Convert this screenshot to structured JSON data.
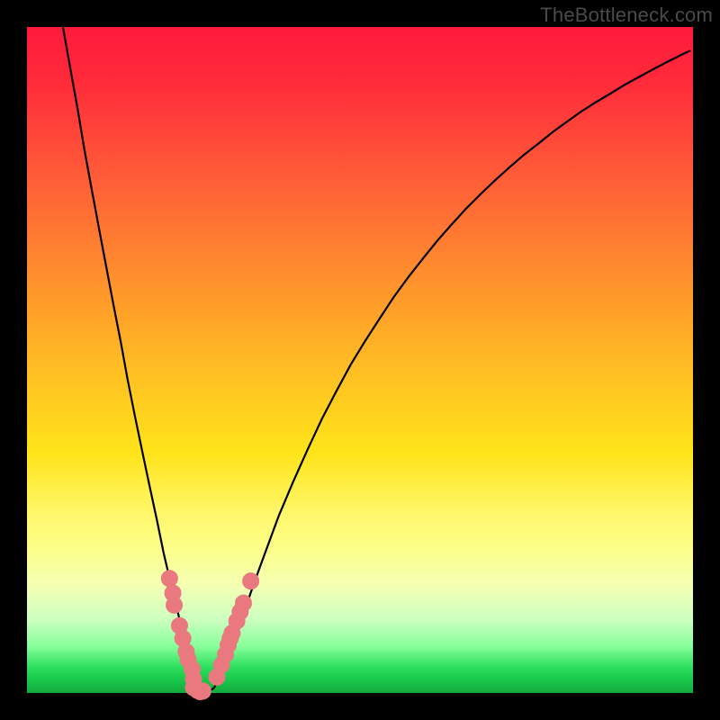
{
  "attribution": "TheBottleneck.com",
  "chart_data": {
    "type": "line",
    "title": "",
    "xlabel": "",
    "ylabel": "",
    "xlim": [
      0,
      100
    ],
    "ylim": [
      0,
      100
    ],
    "series": [
      {
        "name": "curve",
        "x": [
          5.4,
          6.5,
          7.6,
          8.6,
          9.7,
          10.8,
          11.9,
          13.0,
          14.1,
          15.1,
          16.2,
          17.3,
          18.4,
          19.5,
          20.5,
          21.6,
          22.1,
          22.7,
          23.2,
          23.5,
          23.8,
          24.3,
          24.9,
          25.9,
          27.0,
          28.1,
          28.6,
          29.2,
          29.7,
          30.3,
          30.8,
          31.4,
          32.4,
          33.5,
          34.6,
          35.7,
          37.8,
          40.0,
          42.2,
          44.3,
          46.5,
          48.6,
          50.8,
          53.0,
          55.1,
          57.3,
          59.5,
          61.6,
          63.8,
          65.9,
          68.1,
          70.3,
          72.4,
          74.6,
          76.8,
          78.9,
          81.1,
          83.2,
          85.4,
          87.6,
          89.7,
          91.9,
          94.1,
          96.2,
          98.4,
          99.5
        ],
        "values": [
          100.0,
          93.8,
          87.7,
          81.7,
          75.7,
          69.8,
          64.0,
          58.2,
          52.6,
          47.1,
          41.6,
          36.3,
          31.1,
          26.0,
          21.1,
          16.4,
          14.1,
          11.9,
          9.7,
          8.6,
          7.6,
          5.5,
          3.6,
          1.1,
          0.0,
          0.8,
          1.7,
          2.8,
          4.1,
          5.5,
          7.0,
          8.5,
          11.6,
          14.8,
          17.9,
          20.9,
          26.6,
          31.8,
          36.7,
          41.2,
          45.4,
          49.3,
          52.9,
          56.3,
          59.5,
          62.5,
          65.3,
          67.9,
          70.4,
          72.7,
          74.9,
          77.0,
          78.9,
          80.8,
          82.5,
          84.2,
          85.8,
          87.3,
          88.7,
          90.0,
          91.3,
          92.5,
          93.7,
          94.8,
          95.9,
          96.4
        ]
      },
      {
        "name": "data-points",
        "x": [
          21.4,
          21.9,
          22.1,
          22.9,
          23.4,
          23.9,
          24.2,
          24.8,
          25.0,
          25.0,
          25.6,
          26.0,
          26.4,
          28.5,
          29.2,
          29.8,
          30.2,
          30.5,
          30.8,
          31.5,
          32.0,
          32.5,
          33.6
        ],
        "values": [
          17.2,
          15.0,
          13.2,
          10.1,
          8.2,
          6.2,
          5.0,
          3.6,
          2.1,
          0.8,
          0.4,
          0.2,
          0.3,
          2.4,
          4.2,
          5.8,
          7.2,
          8.2,
          9.0,
          10.8,
          12.2,
          13.5,
          16.8
        ]
      }
    ]
  }
}
